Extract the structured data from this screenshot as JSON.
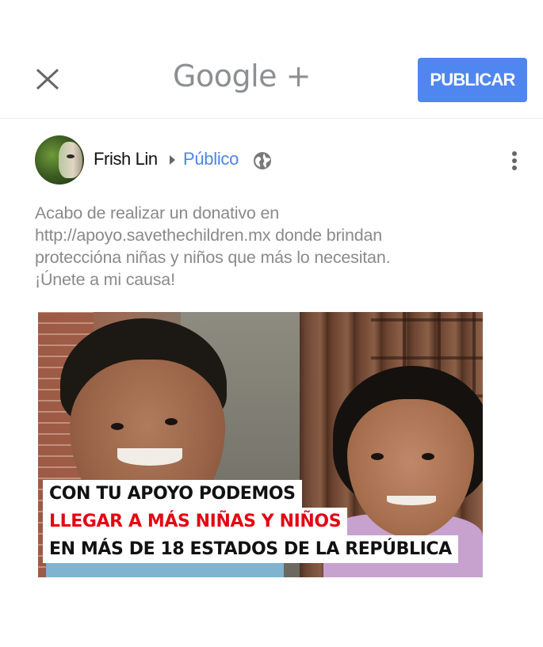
{
  "header": {
    "brand": "Google +",
    "publish_label": "PUBLICAR"
  },
  "post": {
    "author_name": "Frish Lin",
    "audience": "Público",
    "text_lines": [
      "Acabo de realizar un donativo en",
      "http://apoyo.savethechildren.mx donde brindan",
      "protecciónа niñas y niños que más lo necesitan.",
      "¡Únete a mi causa!"
    ]
  },
  "image": {
    "caption_lines": [
      "CON TU APOYO PODEMOS",
      "LLEGAR A MÁS NIÑAS Y NIÑOS",
      "EN MÁS DE 18 ESTADOS DE LA REPÚBLICA"
    ]
  },
  "icons": {
    "close": "close-icon",
    "audience_arrow": "arrow-right-icon",
    "globe": "globe-icon",
    "more": "more-vert-icon"
  },
  "colors": {
    "publish_button": "#4f86f0",
    "audience_link": "#4a86e8",
    "caption_red": "#e30613",
    "post_text": "#8a8a8a"
  }
}
